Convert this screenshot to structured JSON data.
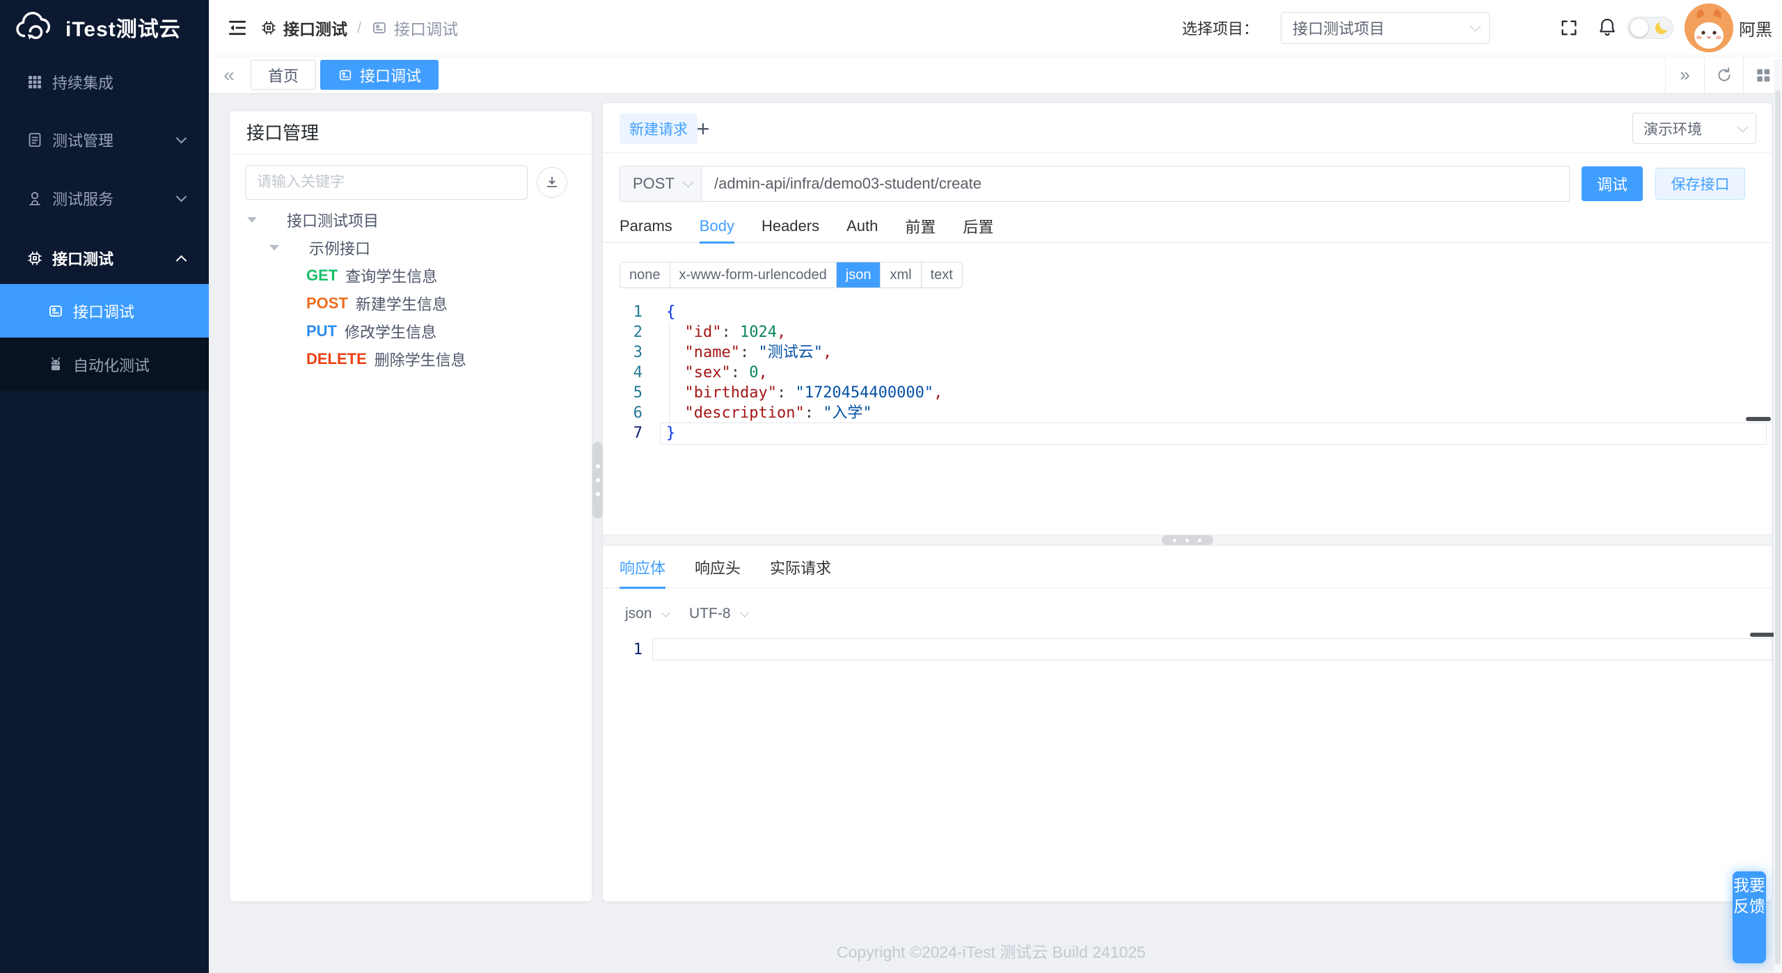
{
  "app": {
    "logo_text": "iTest测试云"
  },
  "colors": {
    "primary": "#409eff",
    "sidebar_bg": "#0c1930",
    "active_item_bg": "#3e9cff"
  },
  "sidebar": {
    "menu": [
      {
        "label": "持续集成",
        "icon": "grid-icon",
        "chevron": null,
        "active": false
      },
      {
        "label": "测试管理",
        "icon": "doc-icon",
        "chevron": "down",
        "active": false
      },
      {
        "label": "测试服务",
        "icon": "person-icon",
        "chevron": "down",
        "active": false
      },
      {
        "label": "接口测试",
        "icon": "chip-icon",
        "chevron": "up",
        "active": true
      }
    ],
    "submenu": [
      {
        "label": "接口调试",
        "icon": "debug-card-icon",
        "active": true
      },
      {
        "label": "自动化测试",
        "icon": "robot-icon",
        "active": false
      }
    ]
  },
  "header": {
    "breadcrumb": [
      {
        "label": "接口测试",
        "icon": "chip-icon"
      },
      {
        "label": "接口调试",
        "icon": "debug-card-icon"
      }
    ],
    "separator": "/",
    "project_label": "选择项目：",
    "project_select": "接口测试项目",
    "username": "阿黑"
  },
  "tabbar": {
    "back_icon": "«",
    "forward_icon": "»",
    "tabs": [
      {
        "label": "首页",
        "icon": null,
        "active": false
      },
      {
        "label": "接口调试",
        "icon": "debug-card-icon",
        "active": true
      }
    ]
  },
  "left_panel": {
    "title": "接口管理",
    "search_placeholder": "请输入关键字",
    "tree": [
      {
        "type": "folder",
        "label": "接口测试项目",
        "indent": 0
      },
      {
        "type": "folder",
        "label": "示例接口",
        "indent": 1
      },
      {
        "type": "api",
        "method": "GET",
        "label": "查询学生信息",
        "color": "#19be6b"
      },
      {
        "type": "api",
        "method": "POST",
        "label": "新建学生信息",
        "color": "#ed6d1e"
      },
      {
        "type": "api",
        "method": "PUT",
        "label": "修改学生信息",
        "color": "#2d8cf0"
      },
      {
        "type": "api",
        "method": "DELETE",
        "label": "删除学生信息",
        "color": "#ed4014"
      }
    ]
  },
  "request": {
    "tab_label": "新建请求",
    "add_tab_label": "+",
    "env_select": "演示环境",
    "method": "POST",
    "url": "/admin-api/infra/demo03-student/create",
    "debug_label": "调试",
    "save_label": "保存接口",
    "tabs": [
      "Params",
      "Body",
      "Headers",
      "Auth",
      "前置",
      "后置"
    ],
    "active_tab": "Body",
    "body_types": [
      "none",
      "x-www-form-urlencoded",
      "json",
      "xml",
      "text"
    ],
    "active_body_type": "json",
    "code_lines": [
      {
        "num": 1,
        "indent": false,
        "active": false,
        "tokens": [
          {
            "t": "b",
            "v": "{"
          }
        ]
      },
      {
        "num": 2,
        "indent": true,
        "active": false,
        "tokens": [
          {
            "t": "k",
            "v": "\"id\""
          },
          {
            "t": "p",
            "v": ": "
          },
          {
            "t": "n",
            "v": "1024"
          },
          {
            "t": "c",
            "v": ","
          }
        ]
      },
      {
        "num": 3,
        "indent": true,
        "active": false,
        "tokens": [
          {
            "t": "k",
            "v": "\"name\""
          },
          {
            "t": "p",
            "v": ": "
          },
          {
            "t": "s",
            "v": "\"测试云\""
          },
          {
            "t": "c",
            "v": ","
          }
        ]
      },
      {
        "num": 4,
        "indent": true,
        "active": false,
        "tokens": [
          {
            "t": "k",
            "v": "\"sex\""
          },
          {
            "t": "p",
            "v": ": "
          },
          {
            "t": "n",
            "v": "0"
          },
          {
            "t": "c",
            "v": ","
          }
        ]
      },
      {
        "num": 5,
        "indent": true,
        "active": false,
        "tokens": [
          {
            "t": "k",
            "v": "\"birthday\""
          },
          {
            "t": "p",
            "v": ": "
          },
          {
            "t": "s",
            "v": "\"1720454400000\""
          },
          {
            "t": "c",
            "v": ","
          }
        ]
      },
      {
        "num": 6,
        "indent": true,
        "active": false,
        "tokens": [
          {
            "t": "k",
            "v": "\"description\""
          },
          {
            "t": "p",
            "v": ": "
          },
          {
            "t": "s",
            "v": "\"入学\""
          }
        ]
      },
      {
        "num": 7,
        "indent": false,
        "active": true,
        "tokens": [
          {
            "t": "b",
            "v": "}"
          }
        ]
      }
    ]
  },
  "response": {
    "tabs": [
      "响应体",
      "响应头",
      "实际请求"
    ],
    "active_tab": "响应体",
    "format_select": "json",
    "charset_select": "UTF-8",
    "first_line_number": "1"
  },
  "footer": {
    "copyright": "Copyright ©2024-iTest 测试云 Build 241025"
  },
  "feedback": {
    "label": "我要反馈"
  }
}
